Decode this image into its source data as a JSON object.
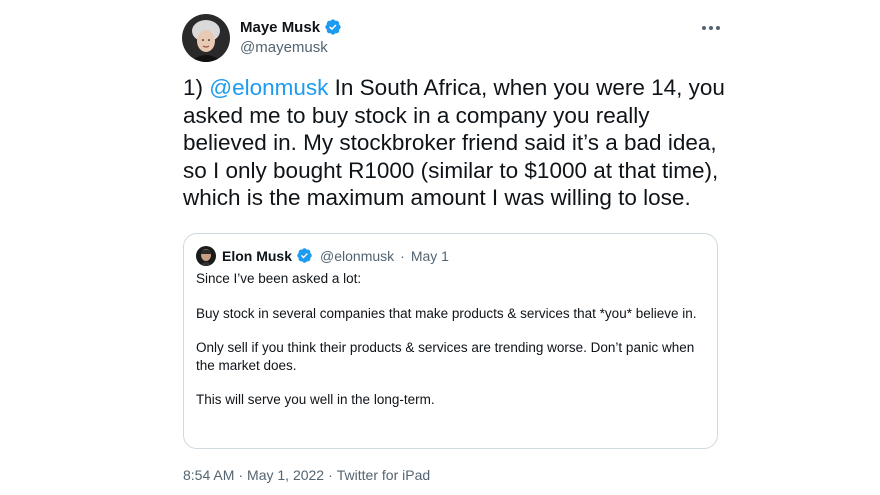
{
  "tweet": {
    "author": {
      "name": "Maye Musk",
      "handle": "@mayemusk"
    },
    "text": {
      "prefix": "1) ",
      "mention": "@elonmusk",
      "body": " In South Africa, when you were 14, you asked me to buy stock in a company you really believed in. My stockbroker friend said it’s a bad idea, so I only bought R1000 (similar to $1000 at that time), which is the maximum amount I was willing to lose."
    },
    "quoted": {
      "name": "Elon Musk",
      "handle": "@elonmusk",
      "date": "May 1",
      "paragraphs": [
        "Since I’ve been asked a lot:",
        "Buy stock in several companies that make products & services that *you* believe in.",
        "Only sell if you think their products & services are trending worse. Don’t panic when the market does.",
        "This will serve you well in the long-term."
      ]
    },
    "footer": {
      "time": "8:54 AM",
      "date": "May 1, 2022",
      "source": "Twitter for iPad"
    }
  },
  "colors": {
    "accent": "#1d9bf0",
    "text": "#0f1419",
    "muted": "#536471",
    "border": "#cfd9de"
  },
  "icons": {
    "verified": "verified-badge-icon",
    "more": "more-horizontal-icon"
  }
}
